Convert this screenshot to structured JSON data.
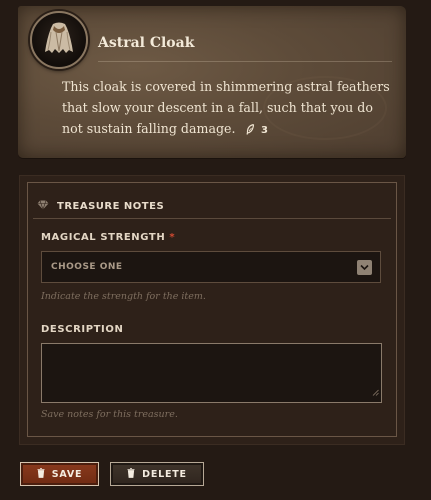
{
  "item": {
    "name": "Astral Cloak",
    "description": "This cloak is covered in shimmering astral feathers that slow your descent in a fall, such that you do not sustain falling damage.",
    "cost": "3",
    "avatar_icon": "cloak-icon",
    "cost_icon": "feather-icon"
  },
  "notes": {
    "section_title": "TREASURE NOTES",
    "section_icon": "gem-icon",
    "strength_label": "MAGICAL STRENGTH",
    "required_mark": "*",
    "strength_value": "CHOOSE ONE",
    "strength_hint": "Indicate the strength for the item.",
    "description_label": "DESCRIPTION",
    "description_value": "",
    "description_hint": "Save notes for this treasure."
  },
  "actions": {
    "save_label": "SAVE",
    "delete_label": "DELETE",
    "trash_icon": "trash-icon"
  },
  "colors": {
    "background": "#241a14",
    "parchment": "#5d4b39",
    "required": "#d14a32",
    "save_button": "#7a3117"
  }
}
